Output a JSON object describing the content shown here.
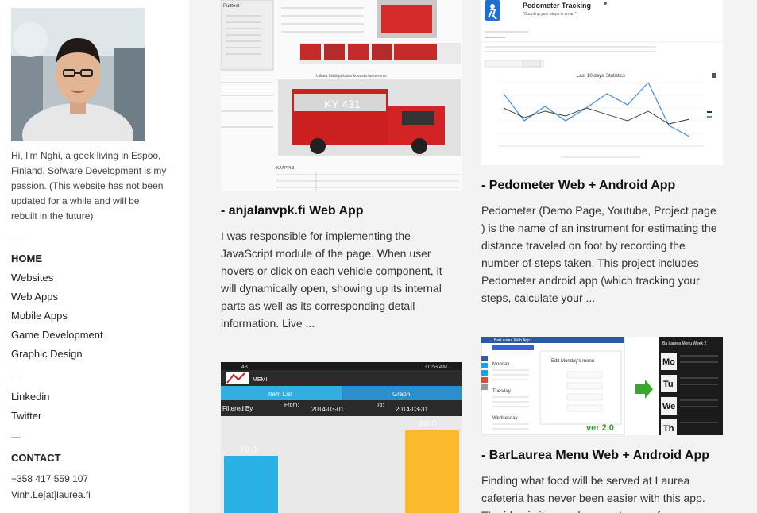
{
  "profile": {
    "bio": "Hi, I'm Nghi, a geek living in Espoo, Finland. Sofware Development is my passion. (This website has not been updated for a while and will be rebuilt in the future)"
  },
  "nav": {
    "home": "HOME",
    "items": [
      "Websites",
      "Web Apps",
      "Mobile Apps",
      "Game Development",
      "Graphic Design"
    ],
    "social": [
      "Linkedin",
      "Twitter"
    ]
  },
  "contact": {
    "title": "CONTACT",
    "phone": "+358 417 559 107",
    "email": "Vinh.Le[at]laurea.fi"
  },
  "projects": [
    {
      "title": "- anjalanvpk.fi Web App",
      "description": "I was responsible for implementing the JavaScript module of the page. When user hovers or click on each vehicle component, it will dynamically open, showing up its internal parts as well as its corresponding detail information. Live ...",
      "thumb_text": [
        "Puitteet",
        "KY 431",
        "KAAPPI 3",
        "Liikuta hiirtä ja katso kuvasta tarkemmin"
      ]
    },
    {
      "title": "- Pedometer Web + Android App",
      "description": "Pedometer (Demo Page, Youtube, Project page ) is the name of an instrument for estimating the distance traveled on foot by recording the number of steps taken. This project includes Pedometer android app (which tracking your steps, calculate your ...",
      "thumb_text": [
        "Pedometer Tracking",
        "\"Counting your steps is an art\"",
        "Last 10 days' Statistics"
      ]
    },
    {
      "title": "",
      "description": "",
      "thumb_text": [
        "43",
        "11:53 AM",
        "MEMI",
        "Item List",
        "Graph",
        "Filtered By",
        "From:",
        "2014-03-01",
        "To:",
        "2014-03-31",
        "70.0",
        "80.0"
      ]
    },
    {
      "title": "- BarLaurea Menu Web + Android App",
      "description": "Finding what food will be served at Laurea cafeteria has never been easier with this app. The idea is it can take a customer of",
      "thumb_text": [
        "BarLaurea Web App",
        "Monday",
        "Tuesday",
        "Wednesday",
        "Edit Monday's menu",
        "ver 2.0",
        "Mo",
        "Tu",
        "We",
        "Th",
        "Ba Laurea Menu Week 2"
      ]
    }
  ]
}
